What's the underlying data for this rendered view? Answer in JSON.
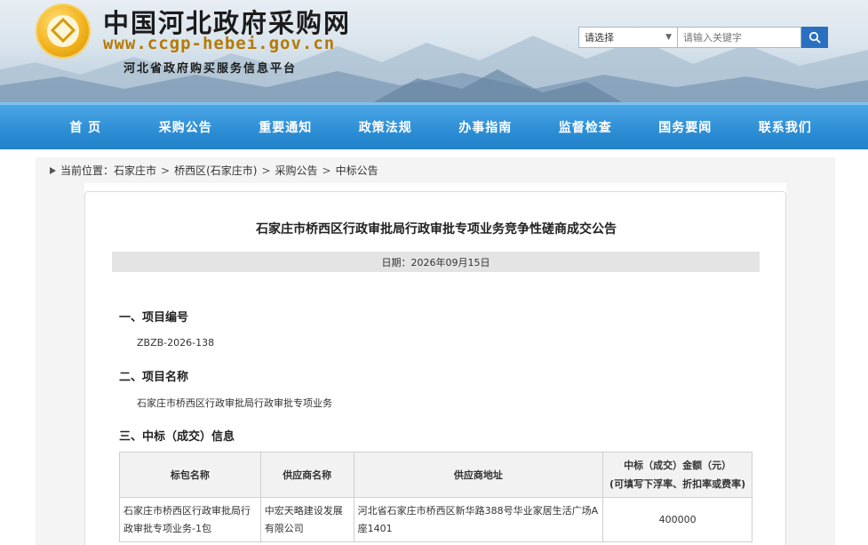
{
  "header": {
    "site_title": "中国河北政府采购网",
    "site_url": "www.ccgp-hebei.gov.cn",
    "site_subtitle": "河北省政府购买服务信息平台",
    "search": {
      "select_value": "请选择",
      "placeholder": "请输入关键字",
      "button_icon": "search-icon"
    }
  },
  "nav": {
    "items": [
      "首 页",
      "采购公告",
      "重要通知",
      "政策法规",
      "办事指南",
      "监督检查",
      "国务要闻",
      "联系我们"
    ]
  },
  "breadcrumb": {
    "prefix": "当前位置：",
    "items": [
      "石家庄市",
      "桥西区(石家庄市)",
      "采购公告",
      "中标公告"
    ],
    "separator": ">"
  },
  "article": {
    "title": "石家庄市桥西区行政审批局行政审批专项业务竞争性磋商成交公告",
    "date": "日期：2026年09月15日",
    "sections": [
      {
        "heading": "一、项目编号",
        "value": "ZBZB-2026-138"
      },
      {
        "heading": "二、项目名称",
        "value": "石家庄市桥西区行政审批局行政审批专项业务"
      },
      {
        "heading": "三、中标（成交）信息",
        "value": ""
      }
    ],
    "table": {
      "headers": [
        "标包名称",
        "供应商名称",
        "供应商地址",
        "中标（成交）金额（元）",
        "(可填写下浮率、折扣率或费率)"
      ],
      "rows": [
        [
          "石家庄市桥西区行政审批局行政审批专项业务-1包",
          "中宏天略建设发展有限公司",
          "河北省石家庄市桥西区新华路388号华业家居生活广场A座1401",
          "400000"
        ]
      ]
    }
  },
  "colors": {
    "nav_blue": "#2f8fd5",
    "search_button": "#2b6fc0",
    "url_gold": "#b57a05"
  }
}
